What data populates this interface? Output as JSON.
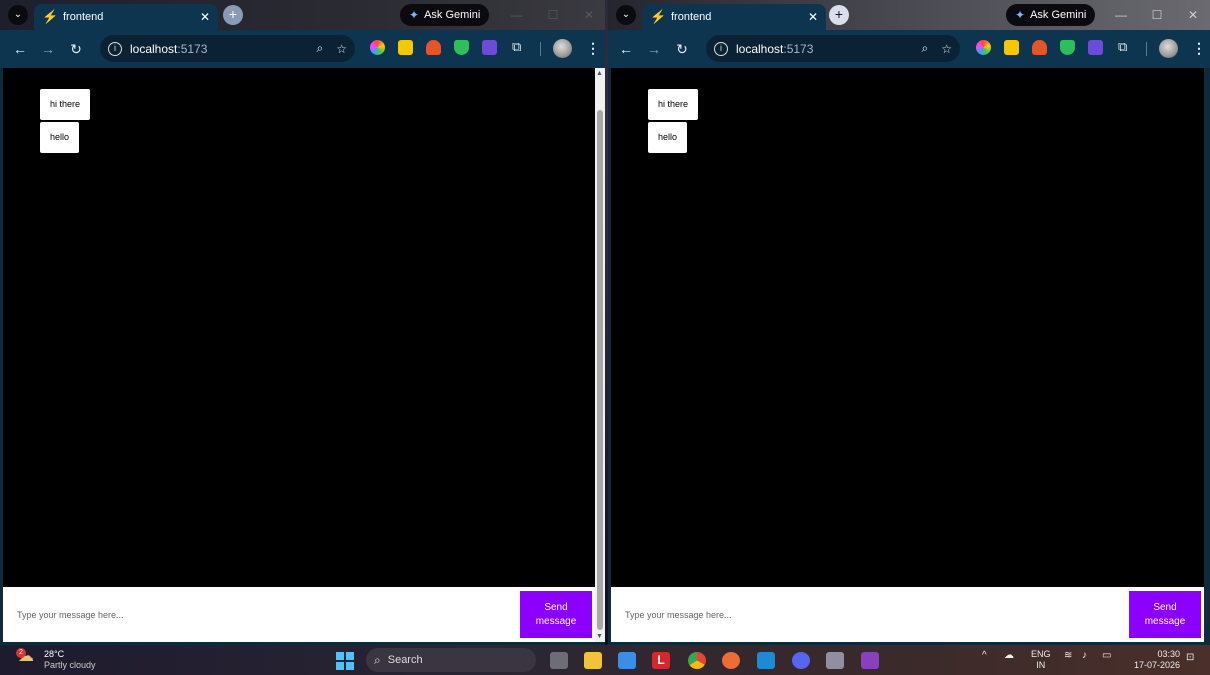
{
  "browsers": [
    {
      "tab": {
        "title": "frontend",
        "close": "✕"
      },
      "gemini_label": "Ask Gemini",
      "url": {
        "host": "localhost",
        "port": ":5173"
      },
      "messages": [
        "hi there",
        "hello"
      ],
      "composer": {
        "placeholder": "Type your message here...",
        "send_label": "Send message"
      }
    },
    {
      "tab": {
        "title": "frontend",
        "close": "✕"
      },
      "gemini_label": "Ask Gemini",
      "url": {
        "host": "localhost",
        "port": ":5173"
      },
      "messages": [
        "hi there",
        "hello"
      ],
      "composer": {
        "placeholder": "Type your message here...",
        "send_label": "Send message"
      }
    }
  ],
  "taskbar": {
    "weather": {
      "temp": "28°C",
      "condition": "Partly cloudy",
      "badge": "2"
    },
    "search_label": "Search",
    "lang": {
      "line1": "ENG",
      "line2": "IN"
    },
    "clock": {
      "time": "03:30",
      "date": "17-07-2026"
    },
    "pinned_icons": [
      "task-view-icon",
      "file-explorer-icon",
      "store-icon",
      "l-app-icon",
      "chrome-icon",
      "postman-icon",
      "vscode-icon",
      "discord-icon",
      "app-icon",
      "winrar-icon"
    ]
  }
}
